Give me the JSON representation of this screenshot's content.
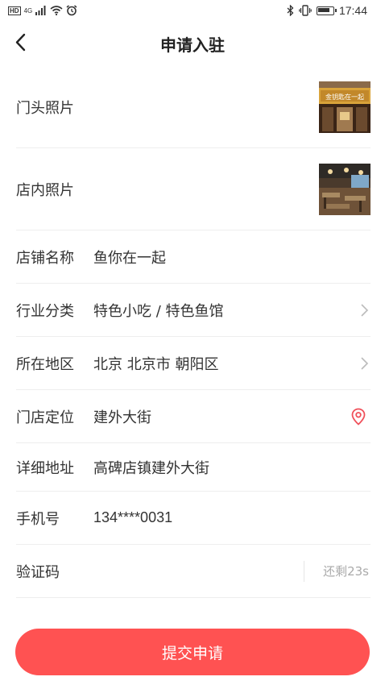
{
  "status_bar": {
    "hd": "HD",
    "network": "4G",
    "time": "17:44",
    "battery_level": 0.9,
    "icons": [
      "hd-icon",
      "signal-icon",
      "wifi-icon",
      "alarm-icon",
      "bluetooth-icon",
      "vibrate-icon",
      "battery-icon"
    ]
  },
  "nav": {
    "title": "申请入驻",
    "back_icon": "back-arrow-icon"
  },
  "form": {
    "front_photo_label": "门头照片",
    "front_photo_sign_text": "金钥匙在一起",
    "interior_photo_label": "店内照片",
    "shop_name_label": "店铺名称",
    "shop_name_value": "鱼你在一起",
    "industry_label": "行业分类",
    "industry_value": "特色小吃 / 特色鱼馆",
    "region_label": "所在地区",
    "region_value": "北京 北京市 朝阳区",
    "location_label": "门店定位",
    "location_value": "建外大街",
    "address_label": "详细地址",
    "address_value": "高碑店镇建外大街",
    "phone_label": "手机号",
    "phone_value": "134****0031",
    "code_label": "验证码",
    "code_value": "",
    "countdown": "还剩23s"
  },
  "submit_label": "提交申请",
  "colors": {
    "accent": "#ff5252",
    "location_pin": "#f0505a",
    "divider": "#eeeeee",
    "muted": "#aaaaaa"
  }
}
